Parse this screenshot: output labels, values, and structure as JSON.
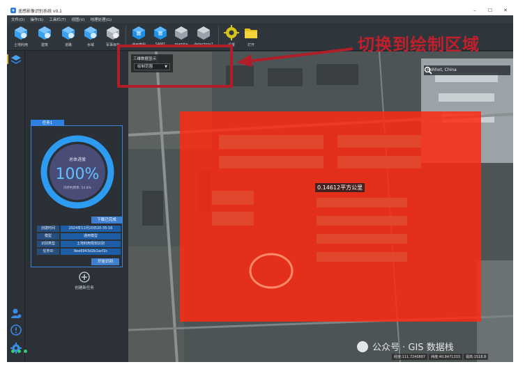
{
  "window": {
    "title": "遥感影像识别系统 v0.1",
    "controls": [
      "–",
      "☐",
      "✕"
    ]
  },
  "menu": [
    "文件(D)",
    "操作(S)",
    "工具栏(T)",
    "视图(V)",
    "地理处理(G)"
  ],
  "toolbar": {
    "group1": [
      "土地利用",
      "建筑",
      "道路",
      "水域",
      "军事目标"
    ],
    "group2": [
      "通用模型",
      "SAM2",
      "mamba",
      "detectron2"
    ],
    "group3": [
      "设置",
      "打开"
    ]
  },
  "task": {
    "tab_label": "任务1",
    "progress_title": "总体进度",
    "progress_value": "100%",
    "progress_fraction": 1.0,
    "usage_text": "内存利用率: 54.8%",
    "download_label": "下载已完成",
    "info": [
      {
        "k": "创建时间",
        "v": "2024年11月20日20:35:16"
      },
      {
        "k": "模型",
        "v": "通用模型"
      },
      {
        "k": "识别类型",
        "v": "土地利用规划识别"
      },
      {
        "k": "任务ID",
        "v": "9ee6943d2b1acf2c"
      }
    ],
    "start_label": "开始识别",
    "new_task_label": "创建新任务"
  },
  "map": {
    "layer_panel_title": "三维数据显示",
    "draw_select_value": "绘制范围",
    "search_value": "Hohhot, China",
    "area_label": "0.14612平方公里",
    "coords": [
      "经度:111.7240887",
      "纬度:40.8471333",
      "视高:1518.8"
    ],
    "overlay_color": "#ff2a10"
  },
  "annotation": {
    "text": "切换到绘制区域",
    "color": "#c21f2c"
  },
  "watermark": "公众号 · GIS 数据栈",
  "colors": {
    "accent": "#2d7fe0",
    "status_green": "#2ecc71",
    "gauge_ring": "#2d9cf0"
  }
}
